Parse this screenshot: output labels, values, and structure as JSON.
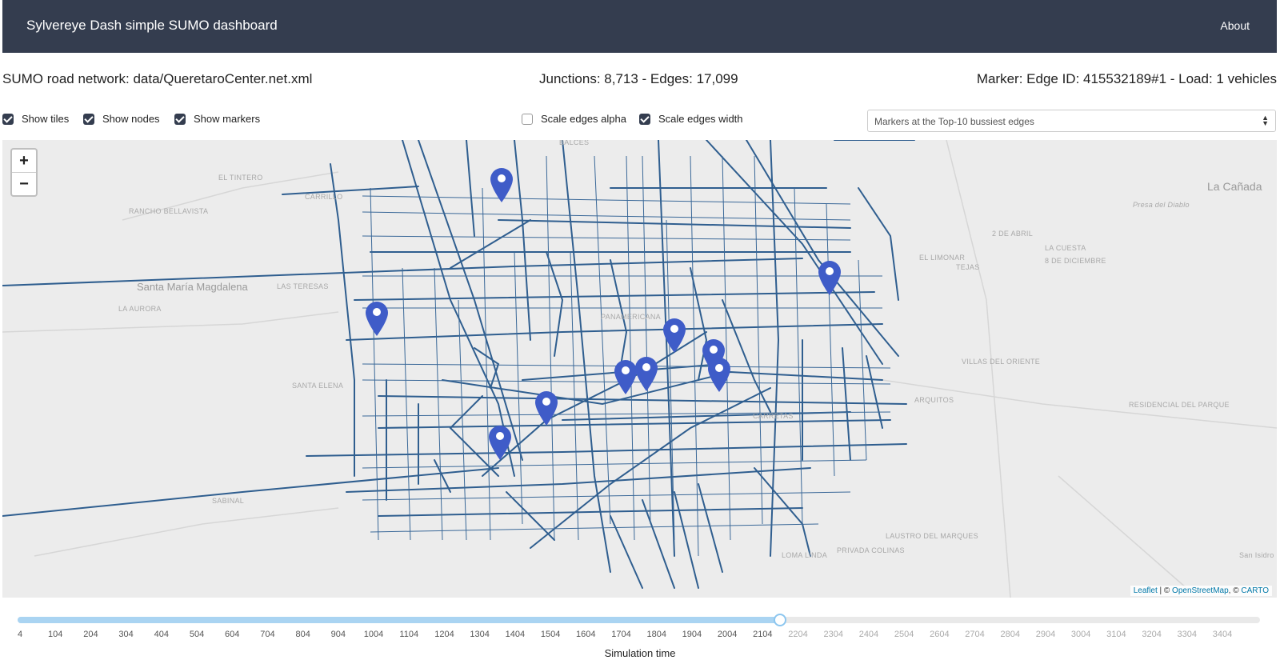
{
  "navbar": {
    "brand": "Sylvereye Dash simple SUMO dashboard",
    "about": "About",
    "bg": "#343d4f"
  },
  "info": {
    "network": "SUMO road network: data/QueretaroCenter.net.xml",
    "counts": "Junctions: 8,713 - Edges: 17,099",
    "marker": "Marker: Edge ID: 415532189#1 - Load: 1 vehicles"
  },
  "options": {
    "show_tiles": {
      "label": "Show tiles",
      "checked": true
    },
    "show_nodes": {
      "label": "Show nodes",
      "checked": true
    },
    "show_markers": {
      "label": "Show markers",
      "checked": true
    },
    "scale_alpha": {
      "label": "Scale edges alpha",
      "checked": false
    },
    "scale_width": {
      "label": "Scale edges width",
      "checked": true
    }
  },
  "marker_select": {
    "value": "Markers at the Top-10 bussiest edges"
  },
  "map": {
    "zoom_in": "+",
    "zoom_out": "−",
    "edge_color": "#2f5e8f",
    "marker_color": "#3f5cc8",
    "attribution": {
      "leaflet": "Leaflet",
      "osm": "OpenStreetMap",
      "carto": "CARTO",
      "sep1": " | © ",
      "sep2": ", © "
    },
    "labels": [
      "EL TINTERO",
      "CARRILLO",
      "RANCHO BELLAVISTA",
      "Santa María Magdalena",
      "LAS TERESAS",
      "LA AURORA",
      "SANTA ELENA",
      "SABINAL",
      "La Cañada",
      "Presa del Diablo",
      "2 DE ABRIL",
      "LA CUESTA",
      "8 DE DICIEMBRE",
      "EL LIMONAR",
      "TEJAS",
      "VILLAS DEL ORIENTE",
      "ARQUITOS",
      "RESIDENCIAL DEL PARQUE",
      "LAUSTRO DEL MARQUES",
      "PRIVADA COLINAS",
      "LOMA LINDA",
      "San Isidro Mirano",
      "PANAMERICANA",
      "CARRETAS",
      "BALCES"
    ]
  },
  "slider": {
    "value": 2154,
    "min": 4,
    "max": 3504,
    "ticks": [
      "4",
      "104",
      "204",
      "304",
      "404",
      "504",
      "604",
      "704",
      "804",
      "904",
      "1004",
      "1104",
      "1204",
      "1304",
      "1404",
      "1504",
      "1604",
      "1704",
      "1804",
      "1904",
      "2004",
      "2104",
      "2204",
      "2304",
      "2404",
      "2504",
      "2604",
      "2704",
      "2804",
      "2904",
      "3004",
      "3104",
      "3204",
      "3304",
      "3404"
    ],
    "label": "Simulation time"
  }
}
